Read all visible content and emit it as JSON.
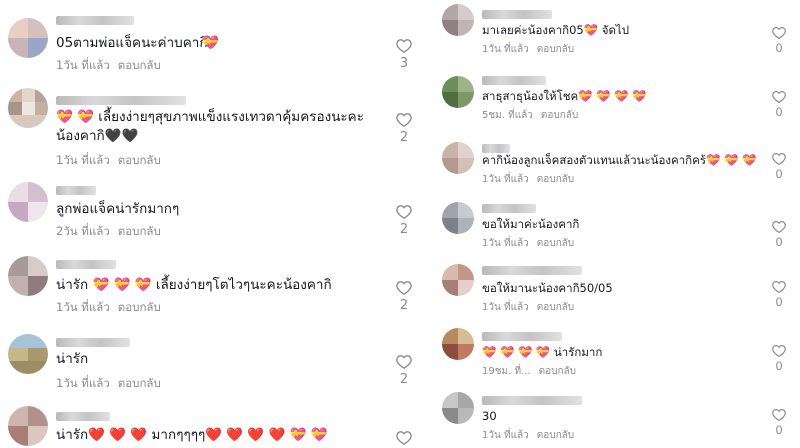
{
  "meta": {
    "reply_label": "ตอบกลับ"
  },
  "left_comments": [
    {
      "text": "05ตามพ่อแจ็คนะค่าบคากิ",
      "emoji_suffix": "💝",
      "time": "1วัน ที่แล้ว",
      "likes": "3"
    },
    {
      "text": "💝 💝 เลี้ยงง่ายๆสุขภาพแข็งแรงเทวดาคุ้มครองนะคะน้องคากิ🖤🖤",
      "time": "1วัน ที่แล้ว",
      "likes": "2"
    },
    {
      "text": "ลูกพ่อแจ็คน่ารักมากๆ",
      "time": "2วัน ที่แล้ว",
      "likes": "2"
    },
    {
      "text": "น่ารัก 💝 💝 💝 เลี้ยงง่ายๆโตไวๆนะคะน้องคากิ",
      "time": "1วัน ที่แล้ว",
      "likes": "2"
    },
    {
      "text": "น่ารัก",
      "time": "1วัน ที่แล้ว",
      "likes": "2"
    },
    {
      "text": "น่ารัก❤️ ❤️ ❤️ มากๆๆๆๆ❤️ ❤️ ❤️ ❤️ 💝 💝",
      "time": "",
      "likes": ""
    }
  ],
  "right_comments": [
    {
      "text": "มาเลยค่ะน้องคากิ05💝 จัดไป",
      "time": "1วัน ที่แล้ว",
      "likes": "0"
    },
    {
      "text": "สาธุสาธุน้องให้โชค💝 💝 💝 💝",
      "time": "5ชม. ที่แล้ว",
      "likes": "0"
    },
    {
      "text": "คากิน้องลูกแจ็คสองตัวแทนแล้วนะน้องคากิคร้💝 💝 💝",
      "time": "1วัน ที่แล้ว",
      "likes": "0"
    },
    {
      "text": "ขอให้มาค่ะน้องคากิ",
      "time": "1วัน ที่แล้ว",
      "likes": "0"
    },
    {
      "text": "ขอให้มานะน้องคากิ50/05",
      "time": "1วัน ที่แล้ว",
      "likes": "0"
    },
    {
      "text": "💝 💝 💝 💝 น่ารักมาก",
      "time": "19ชม. ที่...",
      "likes": "0"
    },
    {
      "text": "30",
      "time": "1วัน ที่แล้ว",
      "likes": "0"
    }
  ],
  "colors": {
    "meta": "#8a8b91",
    "text": "#161823",
    "heart": "#e02b44"
  },
  "icons": {
    "like": "heart-outline-icon",
    "avatar": "pixelated-avatar"
  }
}
